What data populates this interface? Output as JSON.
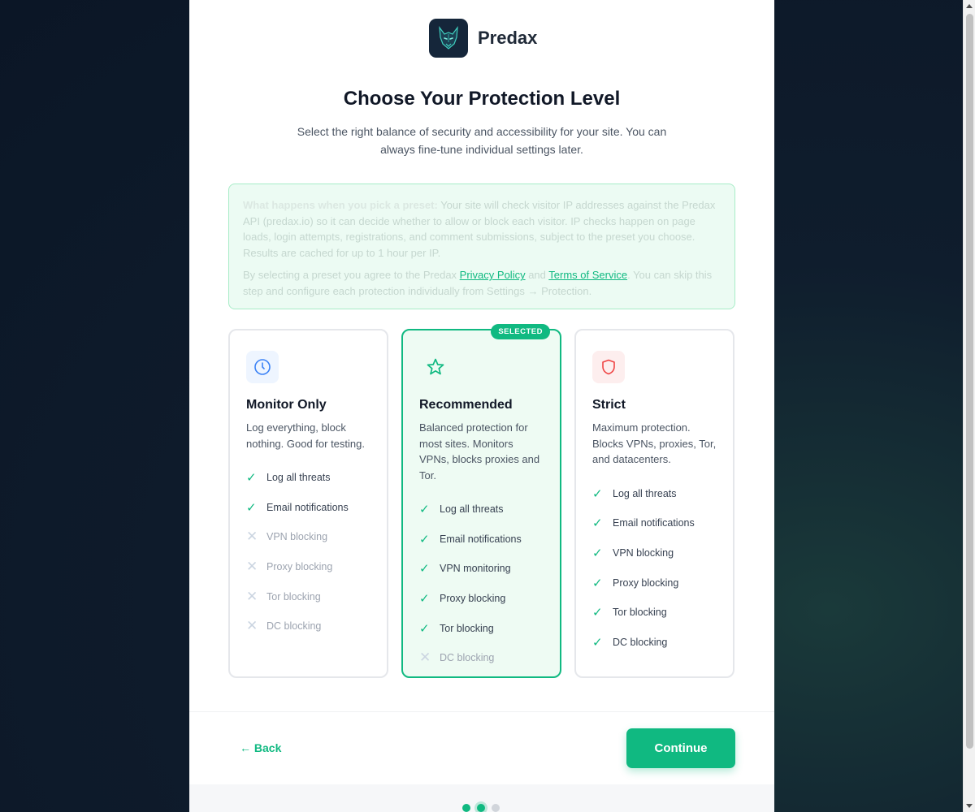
{
  "brand": {
    "name": "Predax"
  },
  "header": {
    "title": "Choose Your Protection Level",
    "subtitle": "Select the right balance of security and accessibility for your site. You can always fine-tune individual settings later."
  },
  "notice": {
    "lead": "What happens when you pick a preset:",
    "body": " Your site will check visitor IP addresses against the Predax API (predax.io) so it can decide whether to allow or block each visitor. IP checks happen on page loads, login attempts, registrations, and comment submissions, subject to the preset you choose. Results are cached for up to 1 hour per IP.",
    "agree_prefix": "By selecting a preset you agree to the Predax ",
    "privacy_link": "Privacy Policy",
    "and": " and ",
    "terms_link": "Terms of Service",
    "agree_suffix": ". You can skip this step and configure each protection individually from Settings → Protection."
  },
  "cards": [
    {
      "title": "Monitor Only",
      "description": "Log everything, block nothing. Good for testing.",
      "icon": "clock-icon",
      "features": [
        {
          "label": "Log all threats",
          "enabled": true
        },
        {
          "label": "Email notifications",
          "enabled": true
        },
        {
          "label": "VPN blocking",
          "enabled": false
        },
        {
          "label": "Proxy blocking",
          "enabled": false
        },
        {
          "label": "Tor blocking",
          "enabled": false
        },
        {
          "label": "DC blocking",
          "enabled": false
        }
      ]
    },
    {
      "title": "Recommended",
      "description": "Balanced protection for most sites. Monitors VPNs, blocks proxies and Tor.",
      "icon": "star-icon",
      "badge": "SELECTED",
      "features": [
        {
          "label": "Log all threats",
          "enabled": true
        },
        {
          "label": "Email notifications",
          "enabled": true
        },
        {
          "label": "VPN monitoring",
          "enabled": true
        },
        {
          "label": "Proxy blocking",
          "enabled": true
        },
        {
          "label": "Tor blocking",
          "enabled": true
        },
        {
          "label": "DC blocking",
          "enabled": false
        }
      ]
    },
    {
      "title": "Strict",
      "description": "Maximum protection. Blocks VPNs, proxies, Tor, and datacenters.",
      "icon": "shield-icon",
      "features": [
        {
          "label": "Log all threats",
          "enabled": true
        },
        {
          "label": "Email notifications",
          "enabled": true
        },
        {
          "label": "VPN blocking",
          "enabled": true
        },
        {
          "label": "Proxy blocking",
          "enabled": true
        },
        {
          "label": "Tor blocking",
          "enabled": true
        },
        {
          "label": "DC blocking",
          "enabled": true
        }
      ]
    }
  ],
  "marks": {
    "on": "✓",
    "off": "✕"
  },
  "footer": {
    "back_label": "← Back",
    "continue_label": "Continue"
  },
  "steps": {
    "total": 3,
    "current": 2
  },
  "colors": {
    "accent": "#10b981",
    "clock": "#3b82f6",
    "shield": "#ef4444"
  }
}
